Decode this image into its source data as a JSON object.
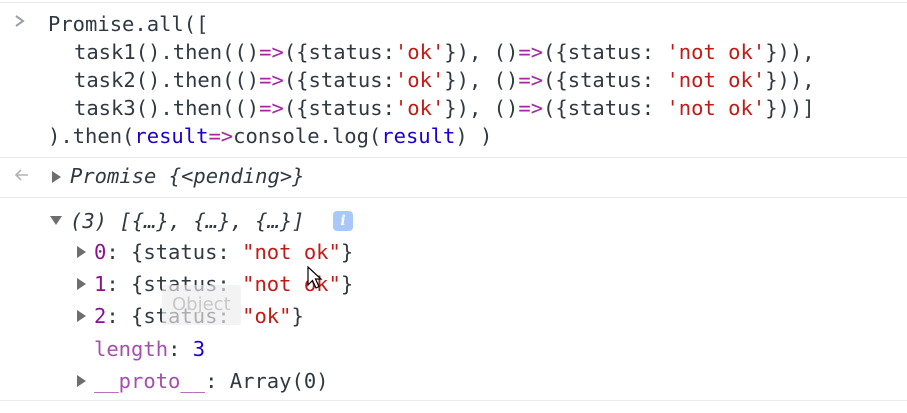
{
  "input": {
    "line1": [
      "Promise.all(["
    ],
    "task_lines": [
      {
        "fn": "task1",
        "p1": "().then(()",
        "arrow": "=>",
        "p2": "({status:",
        "s1": "'ok'",
        "p3": "}), ()",
        "p4": "({status: ",
        "s2": "'not ok'",
        "p5": "})),"
      },
      {
        "fn": "task2",
        "p1": "().then(()",
        "arrow": "=>",
        "p2": "({status:",
        "s1": "'ok'",
        "p3": "}), ()",
        "p4": "({status: ",
        "s2": "'not ok'",
        "p5": "})),"
      },
      {
        "fn": "task3",
        "p1": "().then(()",
        "arrow": "=>",
        "p2": "({status:",
        "s1": "'ok'",
        "p3": "}), ()",
        "p4": "({status: ",
        "s2": "'not ok'",
        "p5": "}))]"
      }
    ],
    "last_line": {
      "p1": ").then(",
      "var1": "result",
      "arrow": "=>",
      "p2": "console.log(",
      "var2": "result",
      "p3": ") )"
    }
  },
  "result_line": {
    "prefix": "Promise ",
    "body": "{<pending>}"
  },
  "array_header": {
    "text": "(3) [{…}, {…}, {…}]",
    "info": "i"
  },
  "items": [
    {
      "index": "0",
      "pre": ": {status: ",
      "value": "\"not ok\"",
      "post": "}"
    },
    {
      "index": "1",
      "pre": ": {status: ",
      "value": "\"not ok\"",
      "post": "}"
    },
    {
      "index": "2",
      "pre": ": {status: ",
      "value": "\"ok\"",
      "post": "}"
    }
  ],
  "length_row": {
    "key": "length",
    "sep": ": ",
    "value": "3"
  },
  "proto_row": {
    "key": "__proto__",
    "sep": ": ",
    "value": "Array(0)"
  },
  "tooltip": "Object",
  "icons": {
    "prompt": "chevron-right-icon",
    "result": "back-arrow-icon",
    "info": "info-icon",
    "cursor": "mouse-pointer-icon"
  },
  "colors": {
    "string": "#c41a16",
    "keyword": "#a626a4",
    "key": "#881391",
    "number": "#1c00cf"
  }
}
